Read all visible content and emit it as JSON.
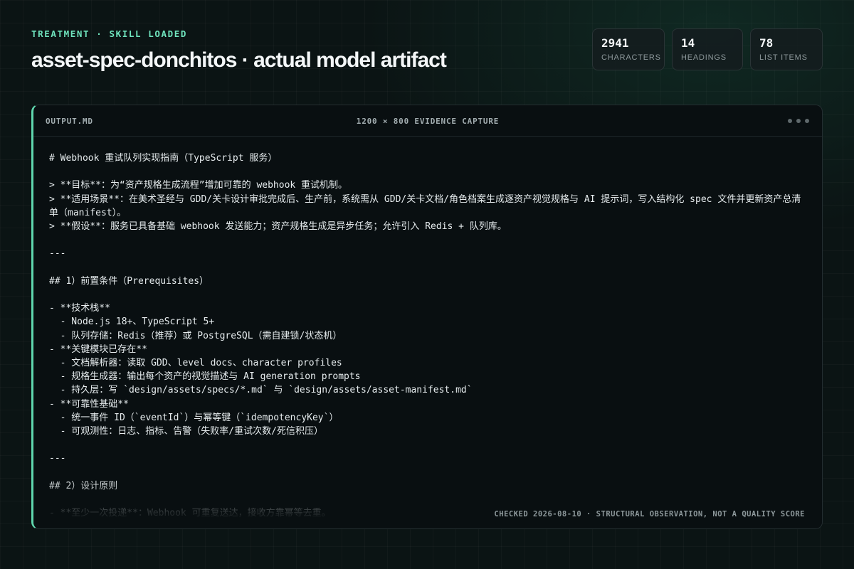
{
  "header": {
    "eyebrow": "TREATMENT · SKILL LOADED",
    "title": "asset-spec-donchitos · actual model artifact"
  },
  "stats": [
    {
      "value": "2941",
      "label": "CHARACTERS"
    },
    {
      "value": "14",
      "label": "HEADINGS"
    },
    {
      "value": "78",
      "label": "LIST ITEMS"
    }
  ],
  "panel": {
    "file_name": "OUTPUT.MD",
    "capture_label": "1200 × 800 EVIDENCE CAPTURE",
    "footer_note": "CHECKED 2026-08-10 · STRUCTURAL OBSERVATION, NOT A QUALITY SCORE",
    "lines": [
      "# Webhook 重试队列实现指南（TypeScript 服务）",
      "",
      "> **目标**：为“资产规格生成流程”增加可靠的 webhook 重试机制。",
      "> **适用场景**：在美术圣经与 GDD/关卡设计审批完成后、生产前，系统需从 GDD/关卡文档/角色档案生成逐资产视觉规格与 AI 提示词，写入结构化 spec 文件并更新资产总清单（manifest）。",
      "> **假设**：服务已具备基础 webhook 发送能力；资产规格生成是异步任务；允许引入 Redis + 队列库。",
      "",
      "---",
      "",
      "## 1）前置条件（Prerequisites）",
      "",
      "- **技术栈**",
      "  - Node.js 18+、TypeScript 5+",
      "  - 队列存储：Redis（推荐）或 PostgreSQL（需自建锁/状态机）",
      "- **关键模块已存在**",
      "  - 文档解析器：读取 GDD、level docs、character profiles",
      "  - 规格生成器：输出每个资产的视觉描述与 AI generation prompts",
      "  - 持久层：写 `design/assets/specs/*.md` 与 `design/assets/asset-manifest.md`",
      "- **可靠性基础**",
      "  - 统一事件 ID（`eventId`）与幂等键（`idempotencyKey`）",
      "  - 可观测性：日志、指标、告警（失败率/重试次数/死信积压）",
      "",
      "---",
      "",
      "## 2）设计原则",
      "",
      "- **至少一次投递**：Webhook 可重复送达，接收方靠幂等去重。"
    ]
  }
}
